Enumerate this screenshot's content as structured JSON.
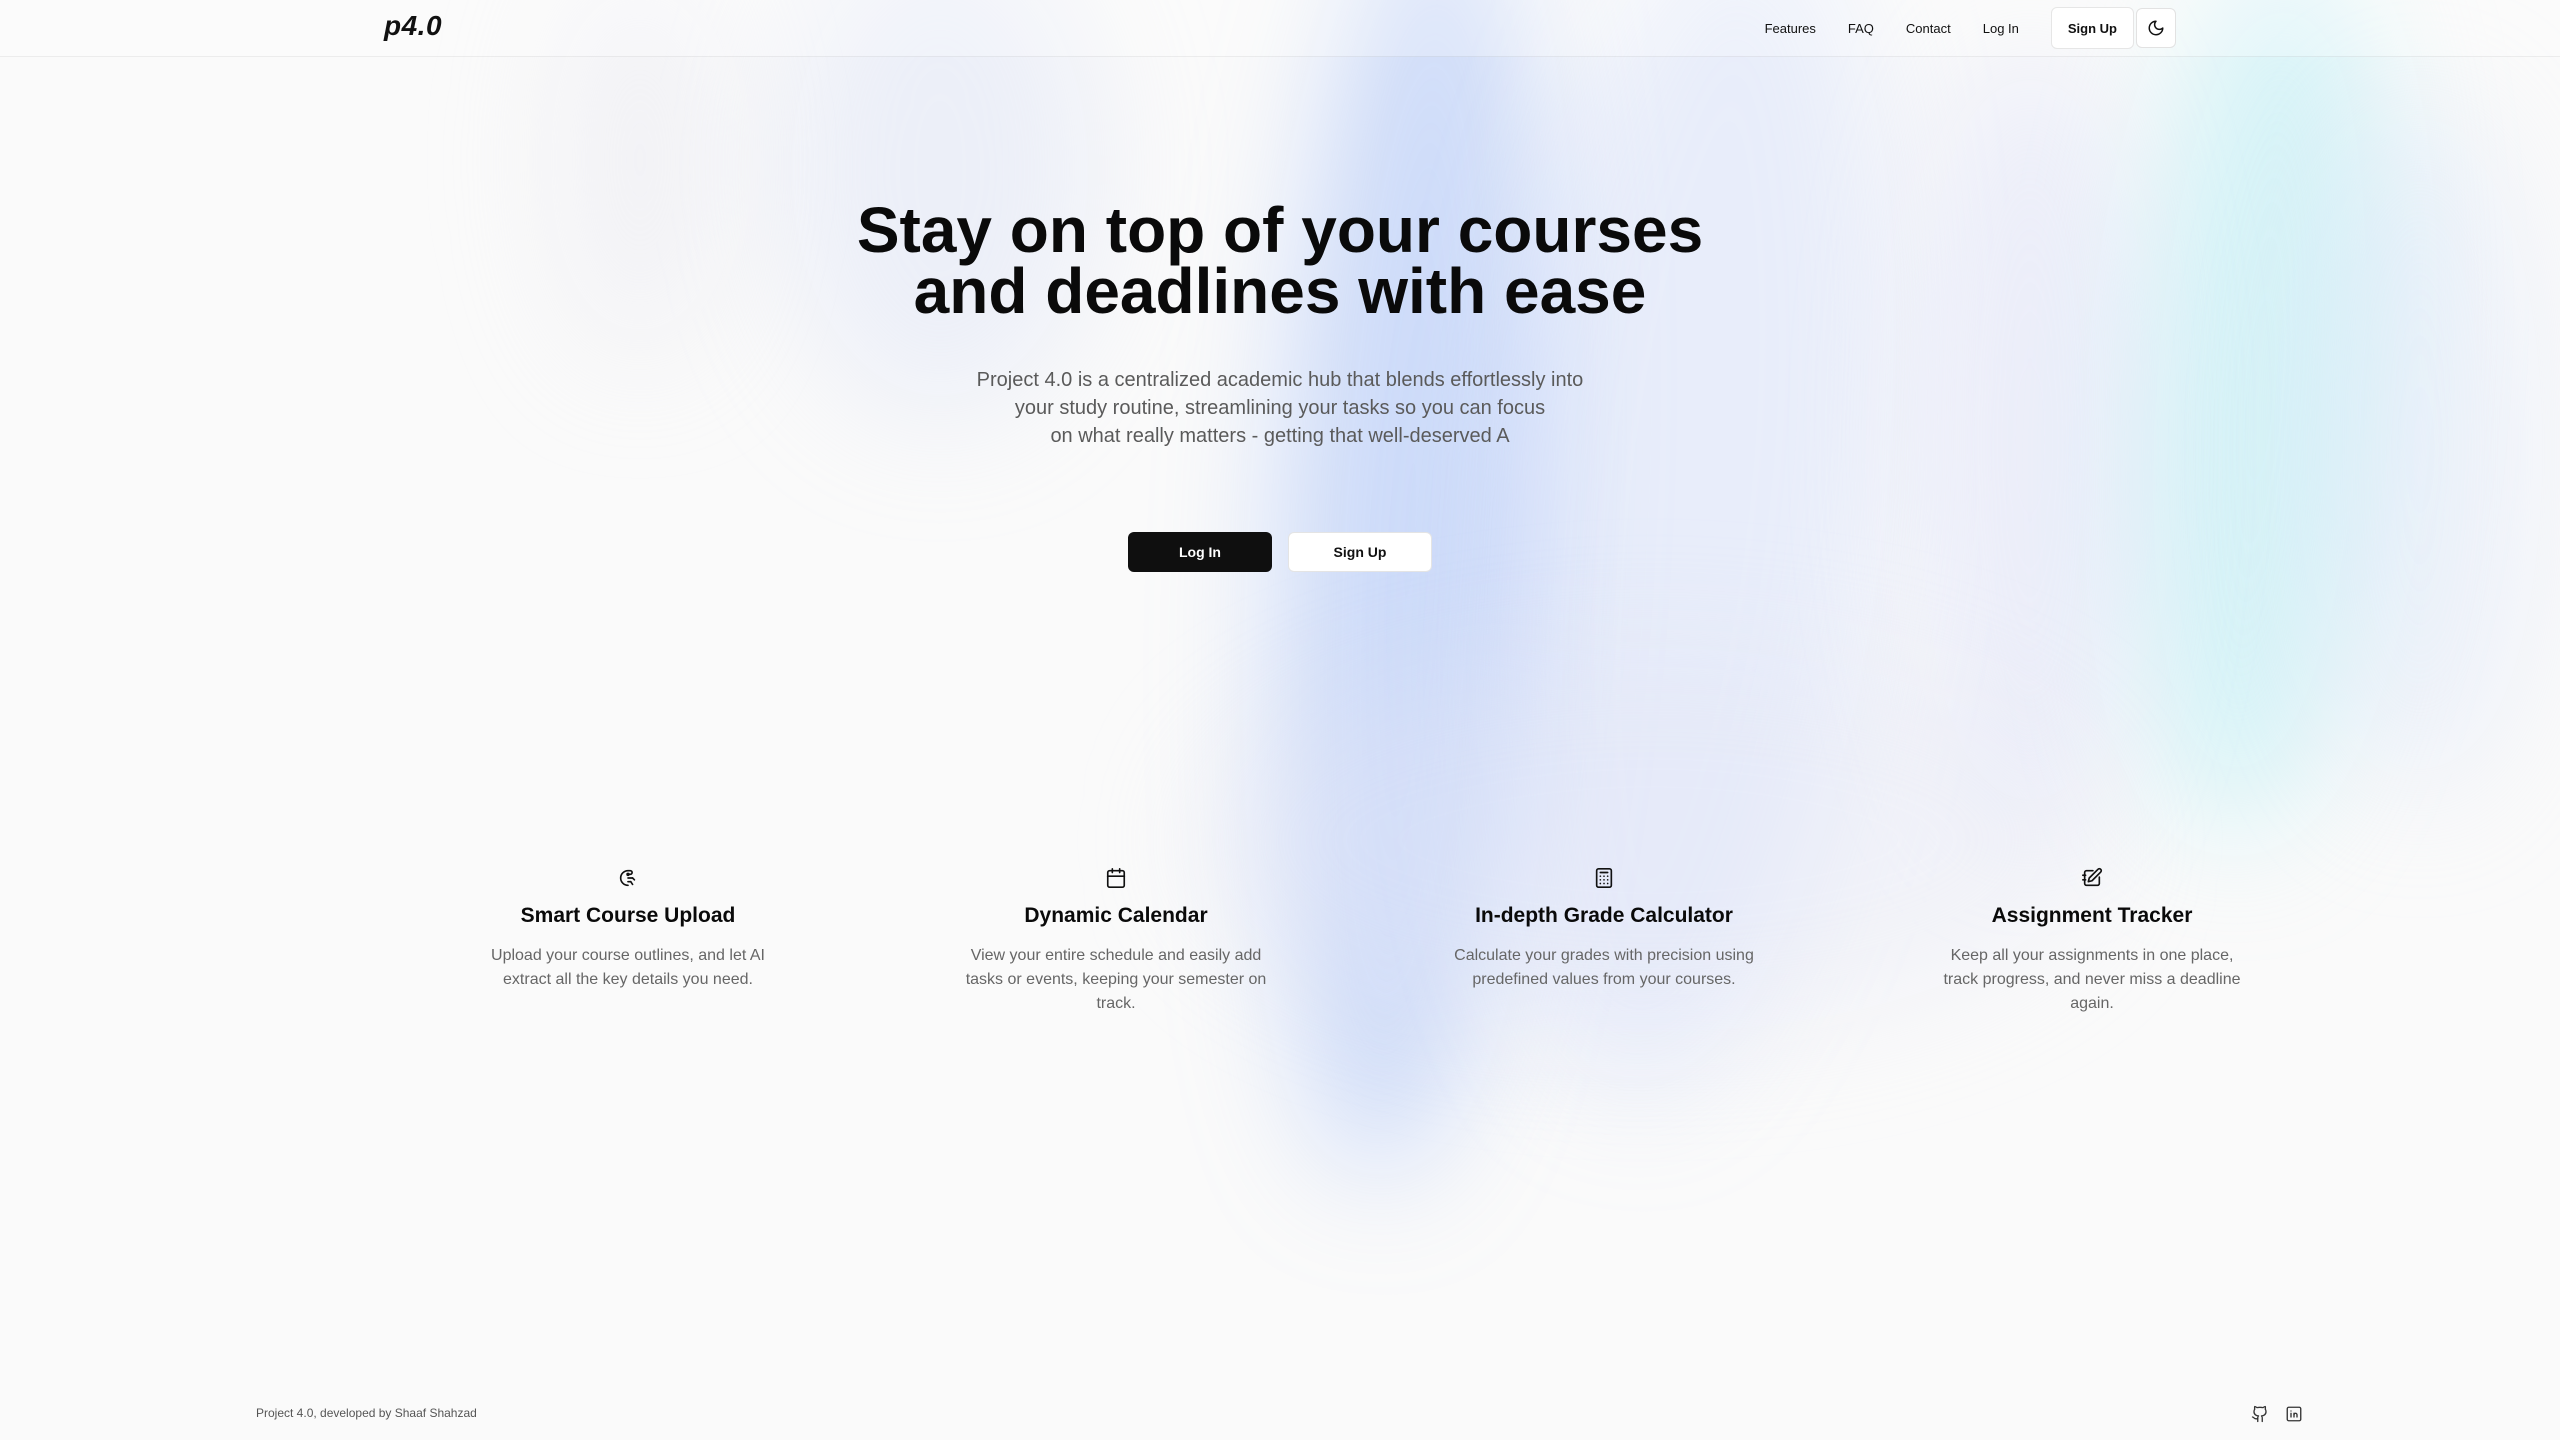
{
  "brand": {
    "logo": "p4.0"
  },
  "nav": {
    "links": [
      "Features",
      "FAQ",
      "Contact",
      "Log In"
    ],
    "signup_label": "Sign Up",
    "theme_icon": "moon-icon"
  },
  "hero": {
    "title_lines": [
      "Stay on top of your courses",
      "and deadlines with ease"
    ],
    "subtitle_lines": [
      "Project 4.0 is a centralized academic hub that blends effortlessly into",
      "your study routine, streamlining your tasks so you can focus",
      "on what really matters - getting that well-deserved A"
    ],
    "login_label": "Log In",
    "signup_label": "Sign Up"
  },
  "features": [
    {
      "icon": "upload-brain-icon",
      "title": "Smart Course Upload",
      "description": "Upload your course outlines, and let AI extract all the key details you need."
    },
    {
      "icon": "calendar-icon",
      "title": "Dynamic Calendar",
      "description": "View your entire schedule and easily add tasks or events, keeping your semester on track."
    },
    {
      "icon": "calculator-icon",
      "title": "In-depth Grade Calculator",
      "description": "Calculate your grades with precision using predefined values from your courses."
    },
    {
      "icon": "edit-note-icon",
      "title": "Assignment Tracker",
      "description": "Keep all your assignments in one place, track progress, and never miss a deadline again."
    }
  ],
  "footer": {
    "credit": "Project 4.0, developed by Shaaf Shahzad",
    "icons": [
      "github-icon",
      "linkedin-icon"
    ]
  }
}
